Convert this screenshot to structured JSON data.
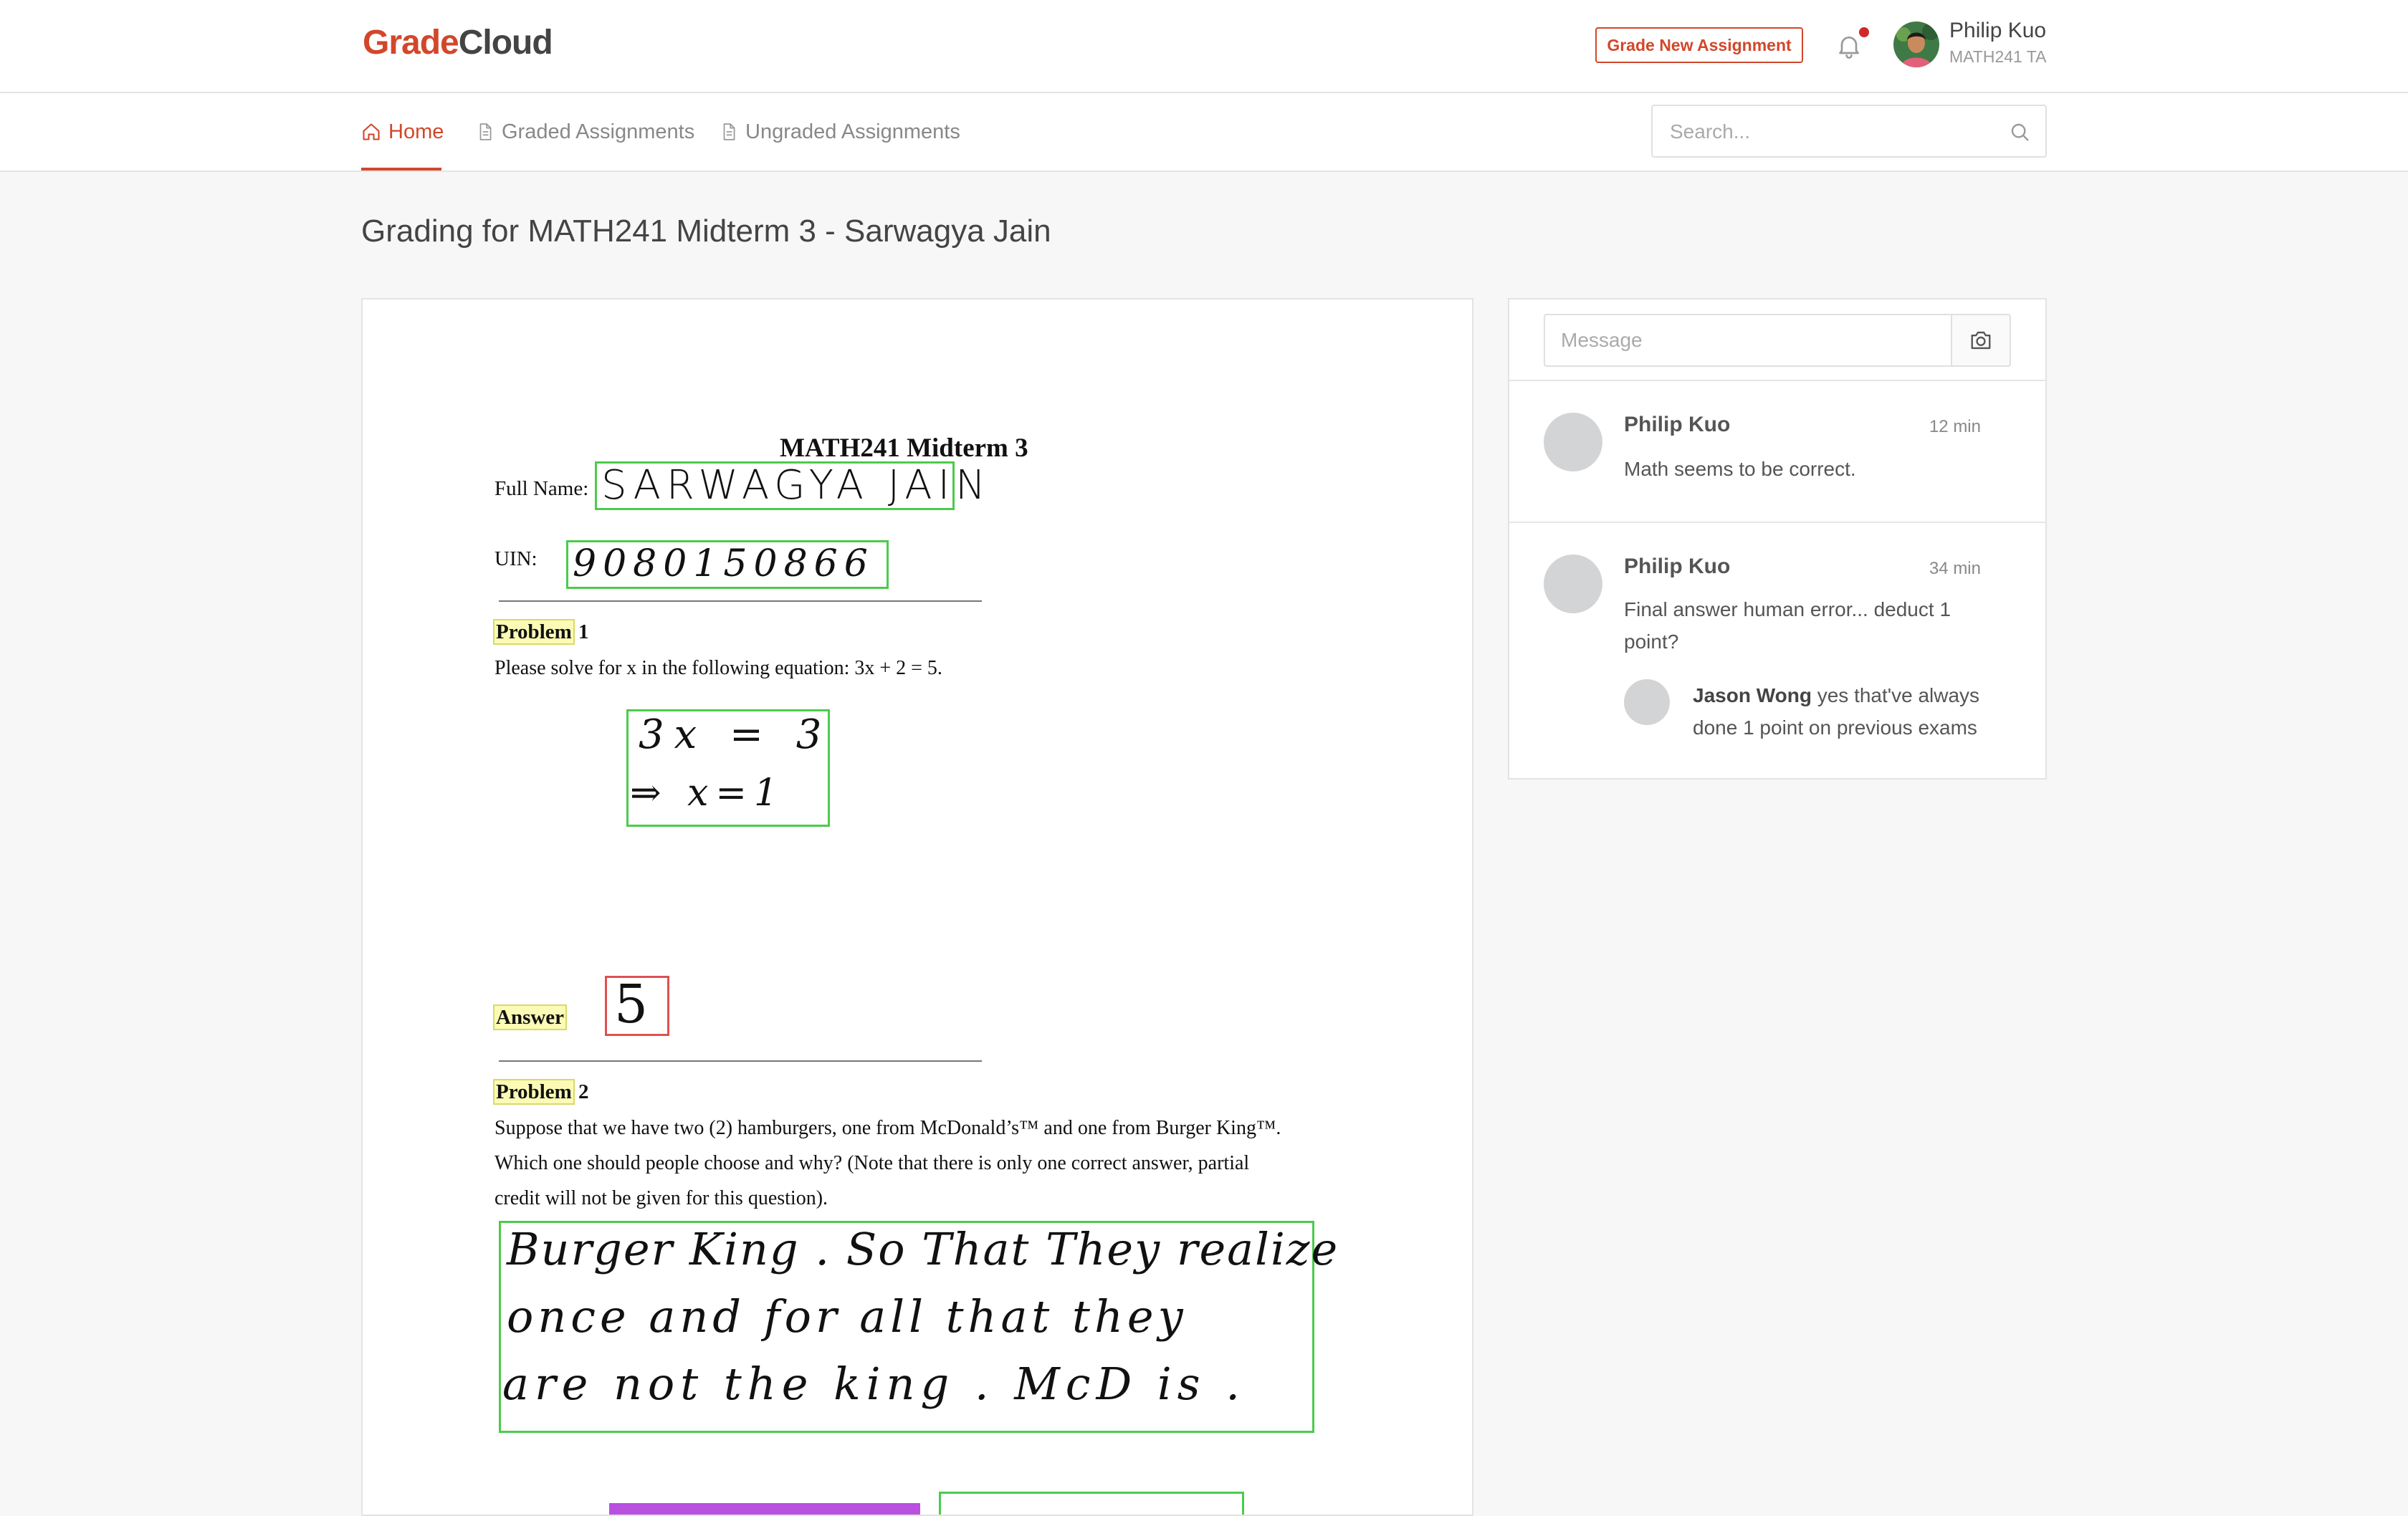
{
  "header": {
    "logo_part1": "Grade",
    "logo_part2": "Cloud",
    "grade_button": "Grade New Assignment",
    "user_name": "Philip Kuo",
    "user_role": "MATH241 TA"
  },
  "nav": {
    "tabs": [
      {
        "label": "Home",
        "icon": "home-icon",
        "active": true
      },
      {
        "label": "Graded Assignments",
        "icon": "document-icon",
        "active": false
      },
      {
        "label": "Ungraded Assignments",
        "icon": "document-icon",
        "active": false
      }
    ],
    "search_placeholder": "Search..."
  },
  "page_title": "Grading for MATH241 Midterm 3 - Sarwagya Jain",
  "document": {
    "title": "MATH241 Midterm 3",
    "full_name_label": "Full Name:",
    "full_name_value": "SARWAGYA JAIN",
    "uin_label": "UIN:",
    "uin_value": "9080150866",
    "problem1_label": "Problem",
    "problem1_number": "1",
    "problem1_text": "Please solve for x in the following equation: 3x + 2 = 5.",
    "work_line1": "3x = 3",
    "work_line2": "⇒ x=1",
    "answer_label": "Answer",
    "answer_value": "5",
    "problem2_label": "Problem",
    "problem2_number": "2",
    "problem2_text_line1": "Suppose that we have two (2) hamburgers, one from McDonald’s™ and one from Burger King™.",
    "problem2_text_line2": "Which one should people choose and why? (Note that there is only one correct answer, partial",
    "problem2_text_line3": "credit will not be given for this question).",
    "answer2_line1": "Burger King . So That They realize",
    "answer2_line2": "once and for all that they",
    "answer2_line3": "are not the king . McD is ."
  },
  "chat": {
    "message_placeholder": "Message",
    "comments": [
      {
        "author": "Philip Kuo",
        "time": "12 min",
        "text": "Math seems to be correct."
      },
      {
        "author": "Philip Kuo",
        "time": "34 min",
        "text_line1": "Final answer human error... deduct 1",
        "text_line2": "point?",
        "reply": {
          "author": "Jason Wong",
          "text": "yes that've always done 1 point on previous exams"
        }
      }
    ]
  },
  "colors": {
    "brand": "#d2472a",
    "box_correct": "#4ccb4c",
    "box_wrong": "#e05050",
    "highlight": "#fbfbb5"
  }
}
